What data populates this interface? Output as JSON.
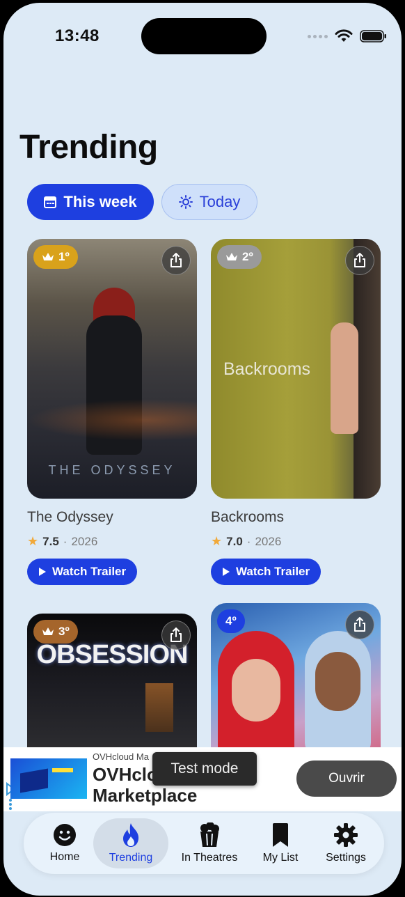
{
  "status": {
    "time": "13:48"
  },
  "page": {
    "title": "Trending"
  },
  "filters": {
    "this_week": "This week",
    "today": "Today"
  },
  "movies": [
    {
      "rank": "1º",
      "title": "The Odyssey",
      "rating": "7.5",
      "year": "2026",
      "poster_text": "THE ODYSSEY",
      "rank_color": "#d9a21b"
    },
    {
      "rank": "2º",
      "title": "Backrooms",
      "rating": "7.0",
      "year": "2026",
      "poster_text": "Backrooms",
      "rank_color": "#9a9a9a"
    },
    {
      "rank": "3º",
      "title": "",
      "rating": "",
      "year": "",
      "poster_text": "OBSESSION",
      "rank_color": "#a5652b"
    },
    {
      "rank": "4º",
      "title": "",
      "rating": "",
      "year": "",
      "poster_text": "",
      "rank_color": "#1e3fe0"
    }
  ],
  "labels": {
    "watch_trailer": "Watch Trailer",
    "dot": "·"
  },
  "ad": {
    "advertiser": "OVHcloud Ma",
    "headline_1": "OVHcloud",
    "headline_2": "Marketplace",
    "button": "Ouvrir",
    "toast": "Test mode"
  },
  "tabs": [
    {
      "label": "Home",
      "icon": "smiley-icon"
    },
    {
      "label": "Trending",
      "icon": "flame-icon",
      "selected": true
    },
    {
      "label": "In Theatres",
      "icon": "popcorn-icon"
    },
    {
      "label": "My List",
      "icon": "bookmark-icon"
    },
    {
      "label": "Settings",
      "icon": "gear-icon"
    }
  ],
  "colors": {
    "accent": "#1e3fe0",
    "background": "#ddeaf6"
  }
}
